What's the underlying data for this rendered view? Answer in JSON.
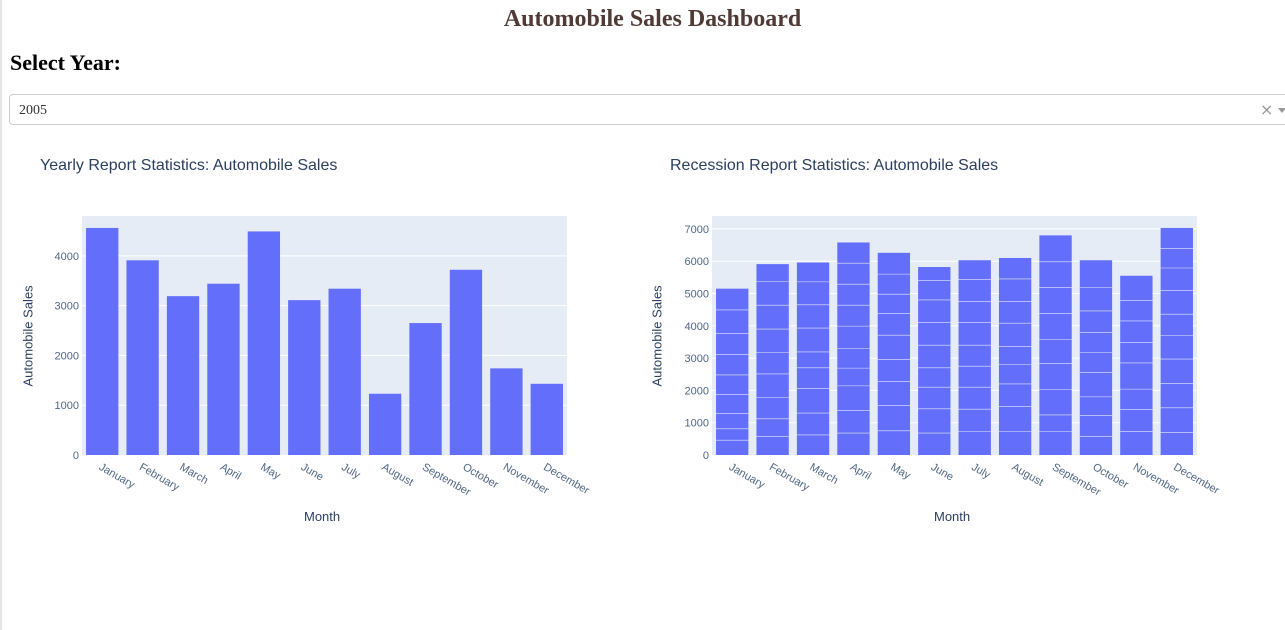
{
  "header": {
    "title": "Automobile Sales Dashboard"
  },
  "year_select": {
    "label": "Select Year:",
    "value": "2005",
    "clear_glyph": "×"
  },
  "colors": {
    "bar": "#636efa",
    "plot_bg": "#e5ecf6",
    "text": "#2a3f5f",
    "title": "#503a36"
  },
  "chart_data": [
    {
      "type": "bar",
      "title": "Yearly Report Statistics: Automobile Sales",
      "xlabel": "Month",
      "ylabel": "Automobile Sales",
      "categories": [
        "January",
        "February",
        "March",
        "April",
        "May",
        "June",
        "July",
        "August",
        "September",
        "October",
        "November",
        "December"
      ],
      "values": [
        4560,
        3910,
        3190,
        3440,
        4490,
        3110,
        3340,
        1230,
        2650,
        3720,
        1740,
        1430
      ],
      "ylim": [
        0,
        4800
      ],
      "yticks": [
        0,
        1000,
        2000,
        3000,
        4000
      ],
      "grid": true
    },
    {
      "type": "bar",
      "title": "Recession Report Statistics: Automobile Sales",
      "xlabel": "Month",
      "ylabel": "Automobile Sales",
      "categories": [
        "January",
        "February",
        "March",
        "April",
        "May",
        "June",
        "July",
        "August",
        "September",
        "October",
        "November",
        "December"
      ],
      "values": [
        5150,
        5910,
        5960,
        6580,
        6260,
        5820,
        6030,
        6100,
        6800,
        6030,
        5550,
        7030
      ],
      "segments": [
        [
          460,
          810,
          1290,
          1880,
          2480,
          3110,
          3760,
          4490
        ],
        [
          580,
          1120,
          1780,
          2510,
          3170,
          3900,
          4640,
          5380
        ],
        [
          620,
          1300,
          2060,
          2700,
          3190,
          3930,
          4650,
          5360
        ],
        [
          680,
          1380,
          2140,
          2690,
          3290,
          3990,
          4640,
          5290,
          5940
        ],
        [
          750,
          1530,
          2270,
          2950,
          3710,
          4380,
          4980,
          5600
        ],
        [
          680,
          1430,
          2100,
          2700,
          3400,
          4100,
          4800,
          5400
        ],
        [
          720,
          1420,
          2100,
          2750,
          3400,
          4100,
          4760,
          5440
        ],
        [
          720,
          1500,
          2200,
          2810,
          3360,
          4080,
          4750,
          5450
        ],
        [
          720,
          1240,
          2020,
          2830,
          3580,
          4380,
          5180,
          5980
        ],
        [
          570,
          1230,
          1800,
          2560,
          3170,
          3800,
          4460,
          5190
        ],
        [
          730,
          1410,
          2040,
          2850,
          3490,
          4150,
          4790
        ],
        [
          700,
          1460,
          2220,
          2970,
          3700,
          4360,
          5090,
          5790,
          6400
        ]
      ],
      "ylim": [
        0,
        7400
      ],
      "yticks": [
        0,
        1000,
        2000,
        3000,
        4000,
        5000,
        6000,
        7000
      ],
      "grid": true
    }
  ]
}
